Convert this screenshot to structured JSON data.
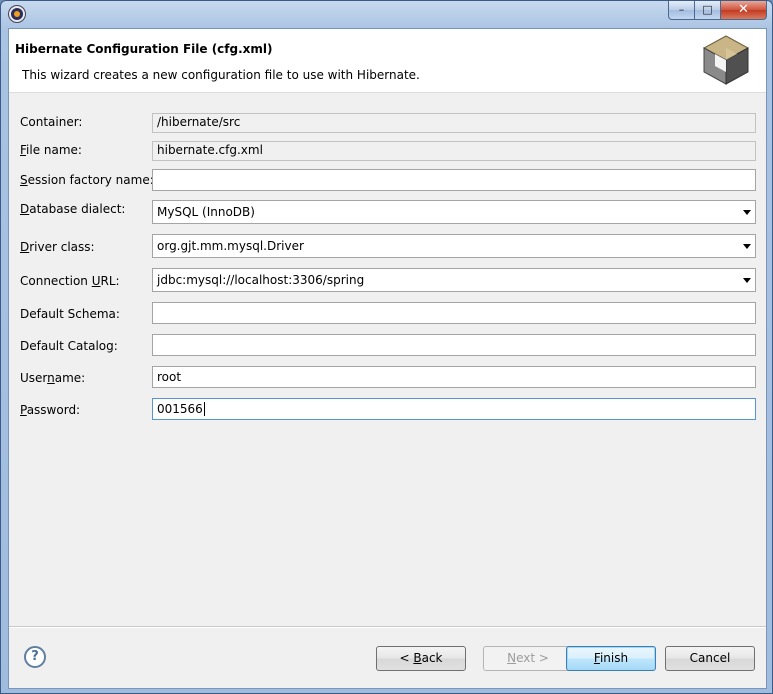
{
  "window": {
    "caption_buttons": {
      "minimize": "–",
      "maximize": "□",
      "close": "✕"
    }
  },
  "banner": {
    "title": "Hibernate Configuration File (cfg.xml)",
    "description": "This wizard creates a new configuration file to use with Hibernate."
  },
  "form": {
    "container": {
      "label": "Container:",
      "value": "/hibernate/src"
    },
    "file_name": {
      "label_u": "F",
      "label_rest": "ile name:",
      "value": "hibernate.cfg.xml"
    },
    "session_factory_name": {
      "label_u": "S",
      "label_rest": "ession factory name:",
      "value": ""
    },
    "database_dialect": {
      "label_u": "D",
      "label_rest": "atabase dialect:",
      "value": "MySQL (InnoDB)"
    },
    "driver_class": {
      "label_u": "D",
      "label_rest": "river class:",
      "value": "org.gjt.mm.mysql.Driver"
    },
    "connection_url": {
      "label_pre": "Connection ",
      "label_u": "U",
      "label_rest": "RL:",
      "value": "jdbc:mysql://localhost:3306/spring"
    },
    "default_schema": {
      "label": "Default Schema:",
      "value": ""
    },
    "default_catalog": {
      "label": "Default Catalog:",
      "value": ""
    },
    "username": {
      "label_pre": "User",
      "label_u": "n",
      "label_rest": "ame:",
      "value": "root"
    },
    "password": {
      "label_u": "P",
      "label_rest": "assword:",
      "value": "001566"
    }
  },
  "footer": {
    "help": "?",
    "back": {
      "pre": "< ",
      "u": "B",
      "rest": "ack"
    },
    "next": {
      "u": "N",
      "rest": "ext >"
    },
    "finish": {
      "u": "F",
      "rest": "inish"
    },
    "cancel": "Cancel"
  }
}
